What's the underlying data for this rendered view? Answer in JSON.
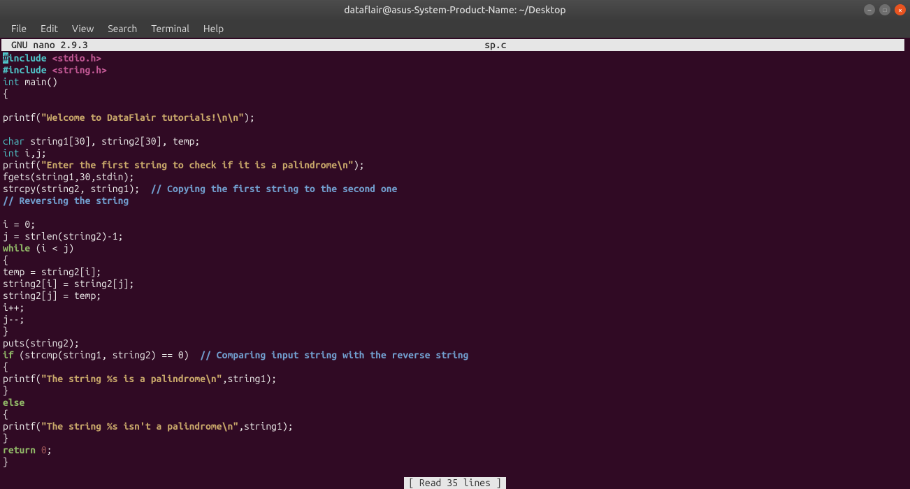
{
  "window": {
    "title": "dataflair@asus-System-Product-Name: ~/Desktop"
  },
  "menubar": {
    "items": [
      "File",
      "Edit",
      "View",
      "Search",
      "Terminal",
      "Help"
    ]
  },
  "nano": {
    "version": "GNU nano 2.9.3",
    "filename": "sp.c",
    "footer_msg": "[ Read 35 lines ]"
  },
  "code": {
    "lines": [
      [
        {
          "c": "cursor",
          "t": "#"
        },
        {
          "c": "pp",
          "t": "include"
        },
        {
          "c": "txt",
          "t": " "
        },
        {
          "c": "hdr",
          "t": "<stdio.h>"
        }
      ],
      [
        {
          "c": "pp",
          "t": "#include"
        },
        {
          "c": "txt",
          "t": " "
        },
        {
          "c": "hdr",
          "t": "<string.h>"
        }
      ],
      [
        {
          "c": "type",
          "t": "int"
        },
        {
          "c": "txt",
          "t": " main()"
        }
      ],
      [
        {
          "c": "txt",
          "t": "{"
        }
      ],
      [],
      [
        {
          "c": "txt",
          "t": "printf("
        },
        {
          "c": "str",
          "t": "\"Welcome to DataFlair tutorials!\\n\\n\""
        },
        {
          "c": "txt",
          "t": ");"
        }
      ],
      [],
      [
        {
          "c": "type",
          "t": "char"
        },
        {
          "c": "txt",
          "t": " string1[30], string2[30], temp;"
        }
      ],
      [
        {
          "c": "type",
          "t": "int"
        },
        {
          "c": "txt",
          "t": " i,j;"
        }
      ],
      [
        {
          "c": "txt",
          "t": "printf("
        },
        {
          "c": "str",
          "t": "\"Enter the first string to check if it is a palindrome\\n\""
        },
        {
          "c": "txt",
          "t": ");"
        }
      ],
      [
        {
          "c": "txt",
          "t": "fgets(string1,30,stdin);"
        }
      ],
      [
        {
          "c": "txt",
          "t": "strcpy(string2, string1);  "
        },
        {
          "c": "cmt",
          "t": "// Copying the first string to the second one"
        }
      ],
      [
        {
          "c": "cmt",
          "t": "// Reversing the string"
        }
      ],
      [],
      [
        {
          "c": "txt",
          "t": "i = 0;"
        }
      ],
      [
        {
          "c": "txt",
          "t": "j = strlen(string2)-1;"
        }
      ],
      [
        {
          "c": "kw",
          "t": "while"
        },
        {
          "c": "txt",
          "t": " (i < j)"
        }
      ],
      [
        {
          "c": "txt",
          "t": "{"
        }
      ],
      [
        {
          "c": "txt",
          "t": "temp = string2[i];"
        }
      ],
      [
        {
          "c": "txt",
          "t": "string2[i] = string2[j];"
        }
      ],
      [
        {
          "c": "txt",
          "t": "string2[j] = temp;"
        }
      ],
      [
        {
          "c": "txt",
          "t": "i++;"
        }
      ],
      [
        {
          "c": "txt",
          "t": "j--;"
        }
      ],
      [
        {
          "c": "txt",
          "t": "}"
        }
      ],
      [
        {
          "c": "txt",
          "t": "puts(string2);"
        }
      ],
      [
        {
          "c": "kw",
          "t": "if"
        },
        {
          "c": "txt",
          "t": " (strcmp(string1, string2) == 0)  "
        },
        {
          "c": "cmt",
          "t": "// Comparing input string with the reverse string"
        }
      ],
      [
        {
          "c": "txt",
          "t": "{"
        }
      ],
      [
        {
          "c": "txt",
          "t": "printf("
        },
        {
          "c": "str",
          "t": "\"The string %s is a palindrome\\n\""
        },
        {
          "c": "txt",
          "t": ",string1);"
        }
      ],
      [
        {
          "c": "txt",
          "t": "}"
        }
      ],
      [
        {
          "c": "kw",
          "t": "else"
        }
      ],
      [
        {
          "c": "txt",
          "t": "{"
        }
      ],
      [
        {
          "c": "txt",
          "t": "printf("
        },
        {
          "c": "str",
          "t": "\"The string %s isn't a palindrome\\n\""
        },
        {
          "c": "txt",
          "t": ",string1);"
        }
      ],
      [
        {
          "c": "txt",
          "t": "}"
        }
      ],
      [
        {
          "c": "kw",
          "t": "return"
        },
        {
          "c": "txt",
          "t": " "
        },
        {
          "c": "num",
          "t": "0"
        },
        {
          "c": "txt",
          "t": ";"
        }
      ],
      [
        {
          "c": "txt",
          "t": "}"
        }
      ]
    ]
  }
}
